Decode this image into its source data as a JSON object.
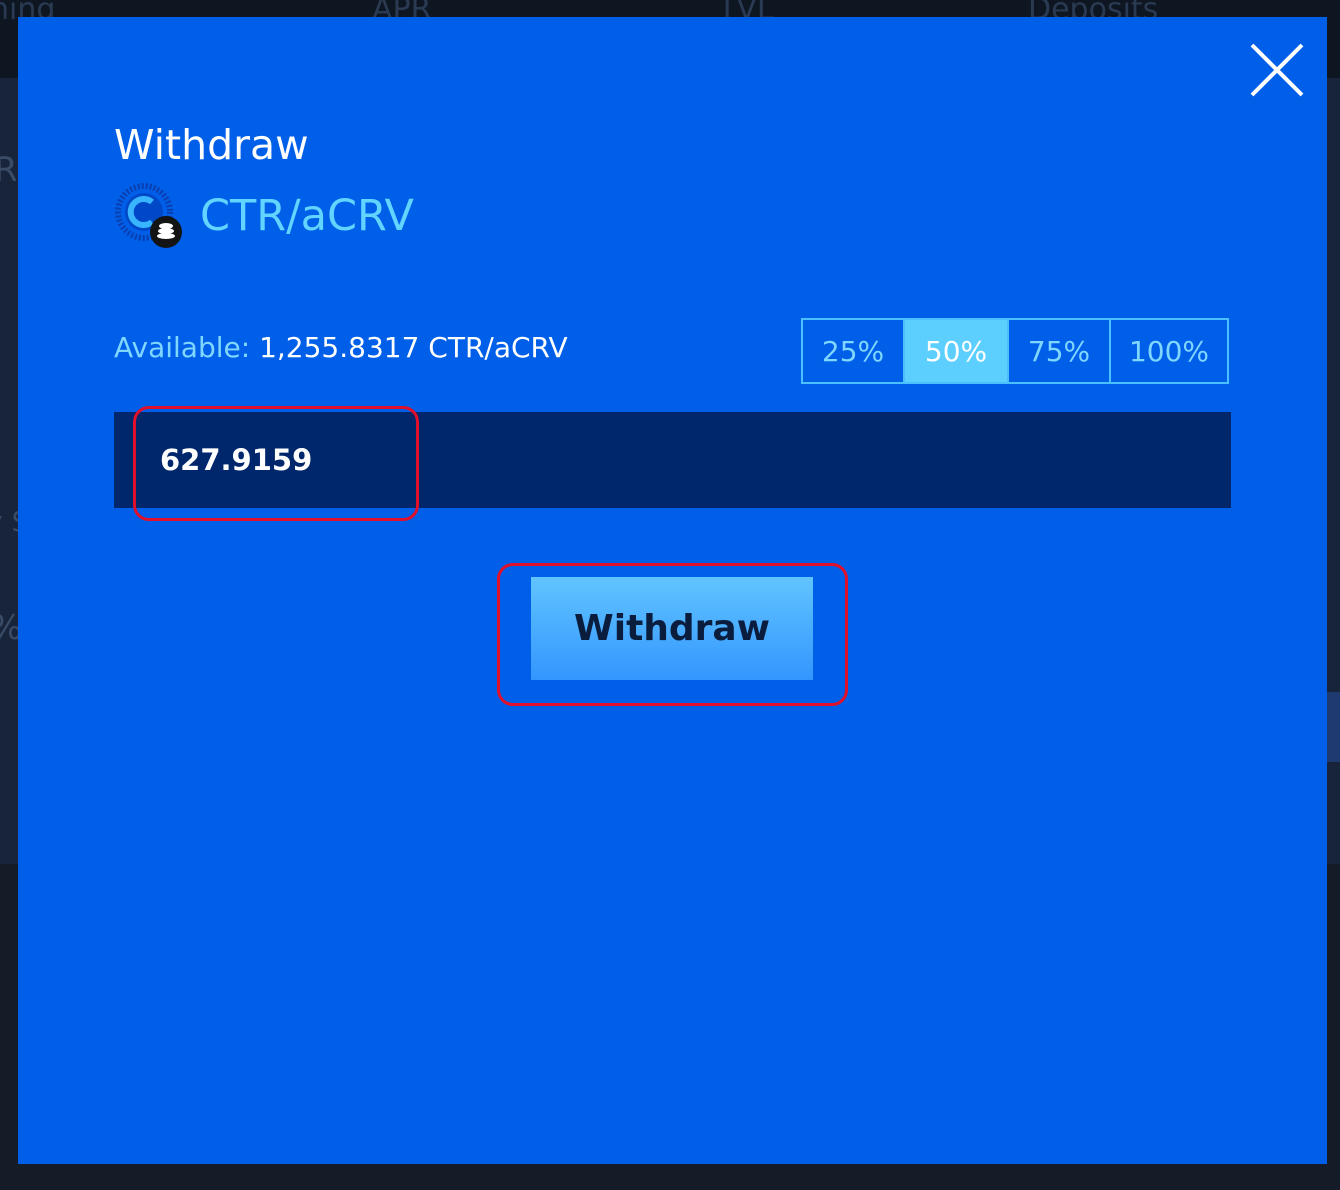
{
  "background": {
    "columns": [
      "ning",
      "APR",
      "TVL",
      "Deposits"
    ],
    "side_texts": [
      "R",
      "y S",
      "%"
    ]
  },
  "modal": {
    "title": "Withdraw",
    "token_name": "CTR/aCRV",
    "available_label": "Available:",
    "available_value": "1,255.8317 CTR/aCRV",
    "percent_options": [
      "25%",
      "50%",
      "75%",
      "100%"
    ],
    "selected_percent": "50%",
    "amount_value": "627.9159",
    "withdraw_button_label": "Withdraw",
    "colors": {
      "modal_bg": "#005fe8",
      "accent": "#61d4ff",
      "input_bg": "#00266b",
      "annotation": "#e0102a"
    },
    "icons": [
      "close-icon",
      "token-icon"
    ]
  }
}
